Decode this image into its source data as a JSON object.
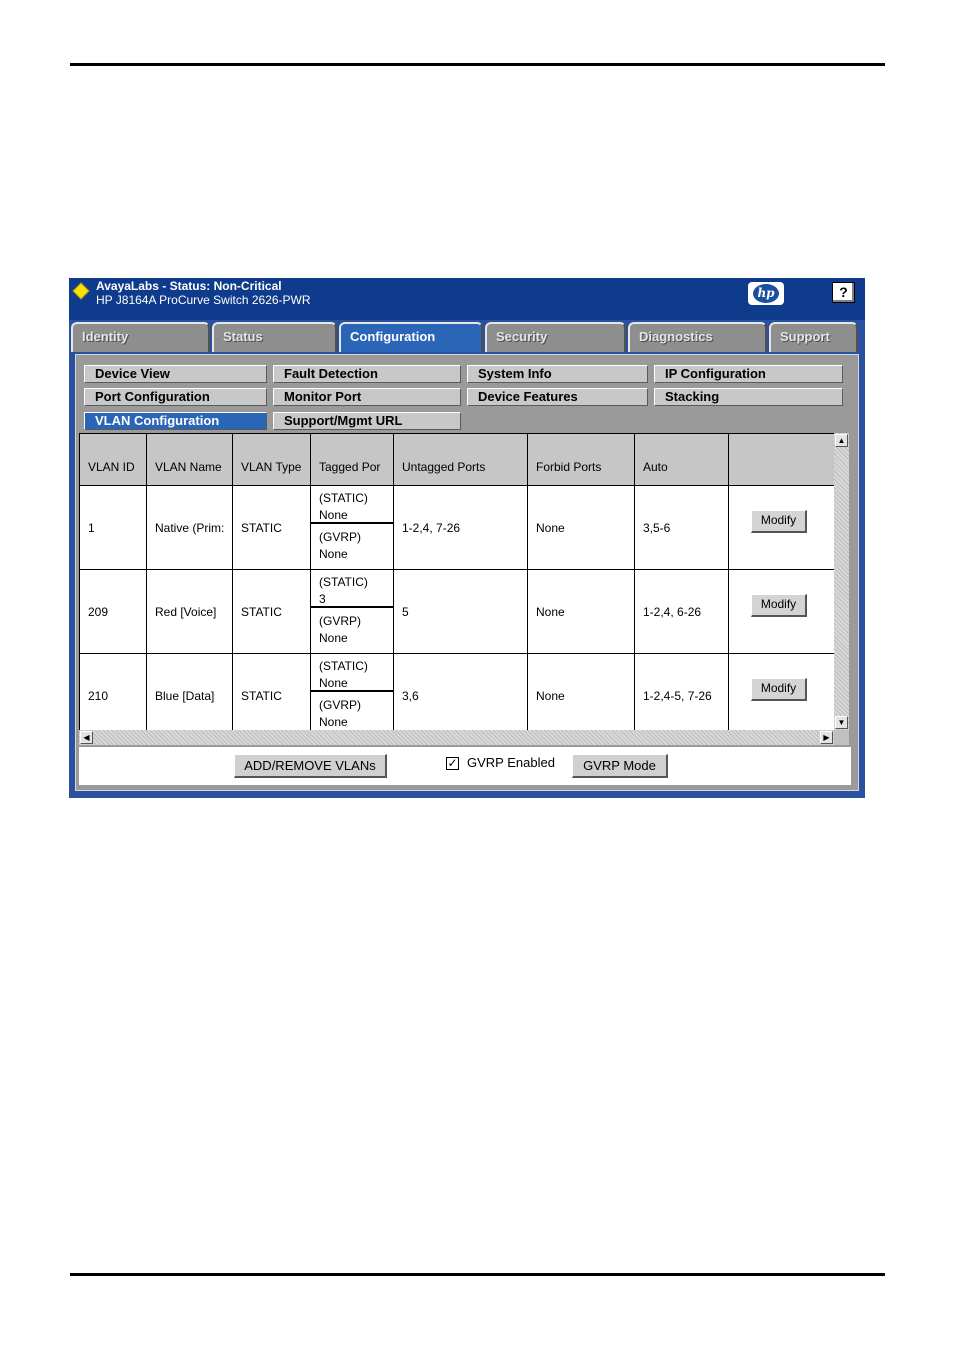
{
  "header": {
    "status_text": "AvayaLabs - Status: Non-Critical",
    "model_text": "HP J8164A ProCurve Switch 2626-PWR",
    "hp_logo": "hp",
    "help_label": "?"
  },
  "tabs": [
    {
      "label": "Identity",
      "active": false
    },
    {
      "label": "Status",
      "active": false
    },
    {
      "label": "Configuration",
      "active": true
    },
    {
      "label": "Security",
      "active": false
    },
    {
      "label": "Diagnostics",
      "active": false
    },
    {
      "label": "Support",
      "active": false
    }
  ],
  "subnav": [
    {
      "label": "Device View"
    },
    {
      "label": "Fault Detection"
    },
    {
      "label": "System Info"
    },
    {
      "label": "IP Configuration"
    },
    {
      "label": "Port Configuration"
    },
    {
      "label": "Monitor Port"
    },
    {
      "label": "Device Features"
    },
    {
      "label": "Stacking"
    },
    {
      "label": "VLAN Configuration",
      "active": true
    },
    {
      "label": "Support/Mgmt URL"
    }
  ],
  "vlan_table": {
    "headers": [
      "VLAN ID",
      "VLAN Name",
      "VLAN Type",
      "Tagged Por",
      "Untagged Ports",
      "Forbid Ports",
      "Auto",
      ""
    ],
    "rows": [
      {
        "id": "1",
        "name": "Native (Prim:",
        "type": "STATIC",
        "tagged_static_label": "(STATIC)",
        "tagged_static": "None",
        "tagged_gvrp_label": "(GVRP)",
        "tagged_gvrp": "None",
        "untagged": "1-2,4, 7-26",
        "forbid": "None",
        "auto": "3,5-6",
        "action": "Modify"
      },
      {
        "id": "209",
        "name": "Red [Voice]",
        "type": "STATIC",
        "tagged_static_label": "(STATIC)",
        "tagged_static": "3",
        "tagged_gvrp_label": "(GVRP)",
        "tagged_gvrp": "None",
        "untagged": "5",
        "forbid": "None",
        "auto": "1-2,4, 6-26",
        "action": "Modify"
      },
      {
        "id": "210",
        "name": "Blue [Data]",
        "type": "STATIC",
        "tagged_static_label": "(STATIC)",
        "tagged_static": "None",
        "tagged_gvrp_label": "(GVRP)",
        "tagged_gvrp": "None",
        "untagged": "3,6",
        "forbid": "None",
        "auto": "1-2,4-5, 7-26",
        "action": "Modify"
      }
    ]
  },
  "footer": {
    "add_remove_label": "ADD/REMOVE VLANs",
    "gvrp_enabled_label": "GVRP Enabled",
    "gvrp_enabled_checked": true,
    "check_glyph": "✓",
    "gvrp_mode_label": "GVRP Mode"
  },
  "colors": {
    "frame_blue": "#2a50a0",
    "header_blue": "#0e3b8c",
    "active_blue": "#2a65b8",
    "status_yellow": "#ffe300"
  }
}
